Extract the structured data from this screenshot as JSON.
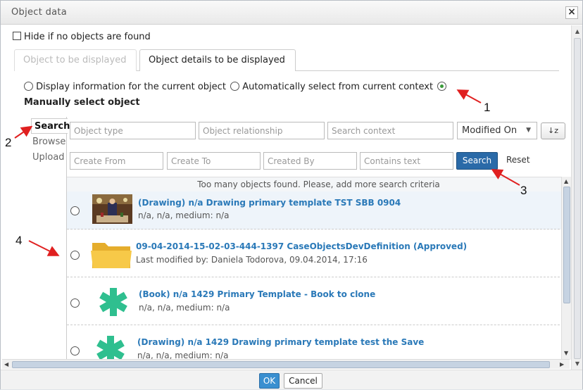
{
  "dialog": {
    "title": "Object data",
    "close_label": "×"
  },
  "options": {
    "hide_label": "Hide if no objects are found"
  },
  "tabs": [
    {
      "label": "Object to be displayed",
      "active": false
    },
    {
      "label": "Object details to be displayed",
      "active": true
    }
  ],
  "radio_options": [
    {
      "label": "Display information for the current object",
      "selected": false
    },
    {
      "label": "Automatically select from current context",
      "selected": false
    },
    {
      "label": "Manually select object",
      "selected": true
    }
  ],
  "sidenav": {
    "items": [
      "Search",
      "Browse",
      "Upload"
    ]
  },
  "search": {
    "object_type_placeholder": "Object type",
    "object_relationship_placeholder": "Object relationship",
    "search_context_placeholder": "Search context",
    "sort_value": "Modified On",
    "sort_icon": "sort-az-icon",
    "sort_icon_text": "↓z",
    "create_from_placeholder": "Create From",
    "create_to_placeholder": "Create To",
    "created_by_placeholder": "Created By",
    "contains_text_placeholder": "Contains text",
    "search_label": "Search",
    "reset_label": "Reset"
  },
  "results": {
    "message": "Too many objects found. Please, add more search criteria",
    "items": [
      {
        "icon": "painting-thumbnail",
        "title": "(Drawing) n/a Drawing primary template TST SBB 0904",
        "subtitle": "n/a, n/a, medium: n/a"
      },
      {
        "icon": "folder-icon",
        "title": "09-04-2014-15-02-03-444-1397 CaseObjectsDevDefinition (Approved)",
        "subtitle": "Last modified by: Daniela Todorova, 09.04.2014, 17:16"
      },
      {
        "icon": "asterisk-icon",
        "title": "(Book) n/a 1429 Primary Template - Book to clone",
        "subtitle": "n/a, n/a, medium: n/a"
      },
      {
        "icon": "asterisk-icon",
        "title": "(Drawing) n/a 1429 Drawing primary template test the Save",
        "subtitle": "n/a, n/a, medium: n/a"
      }
    ]
  },
  "annotations": [
    "1",
    "2",
    "3",
    "4"
  ],
  "footer": {
    "ok_label": "OK",
    "cancel_label": "Cancel"
  },
  "colors": {
    "accent": "#2a6aa8",
    "link": "#2a79b8",
    "asterisk": "#2fbf8f",
    "folder": "#f7c948",
    "annotation_arrow": "#e02020"
  }
}
